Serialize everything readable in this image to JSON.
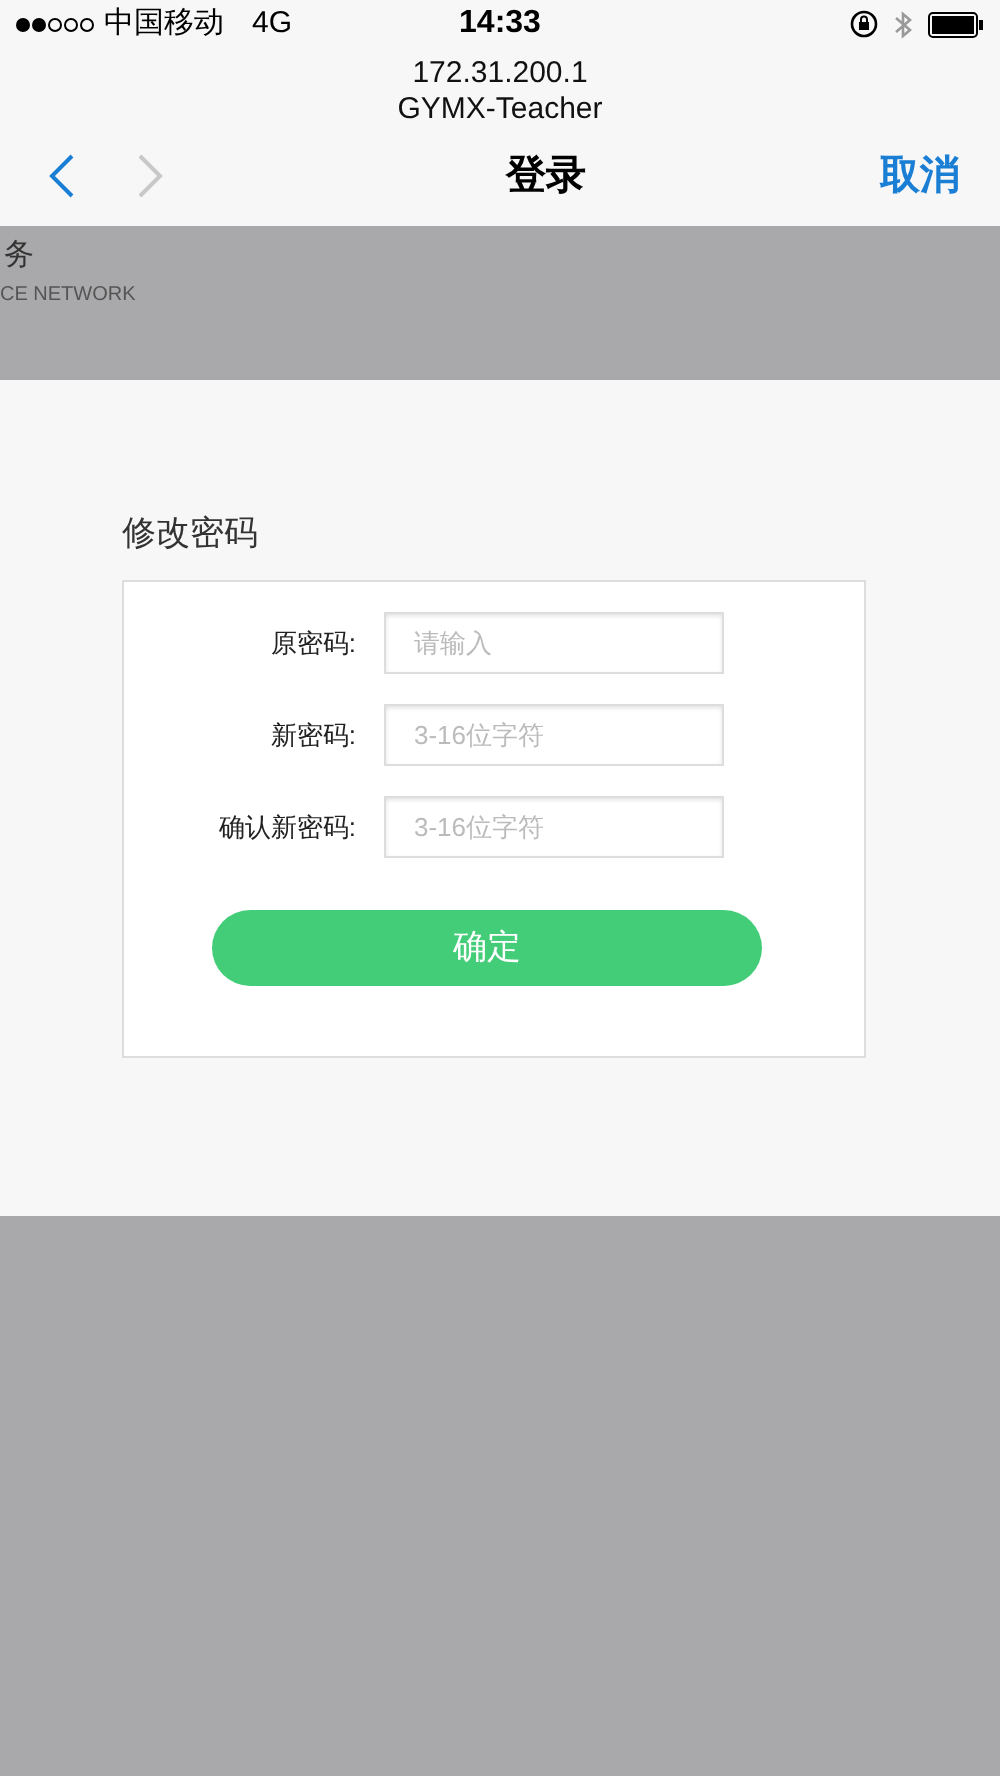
{
  "status_bar": {
    "signal_dots": [
      {
        "filled": true
      },
      {
        "filled": true
      },
      {
        "filled": false
      },
      {
        "filled": false
      },
      {
        "filled": false
      }
    ],
    "carrier": "中国移动",
    "network": "4G",
    "time": "14:33"
  },
  "browser": {
    "address": "172.31.200.1",
    "site_name": "GYMX-Teacher",
    "title": "登录",
    "back": {
      "disabled": false
    },
    "forward": {
      "disabled": true
    },
    "cancel": "取消"
  },
  "background_page": {
    "heading": "务",
    "subheading": "CE NETWORK"
  },
  "dialog": {
    "title": "修改密码",
    "fields": [
      {
        "label": "原密码:",
        "placeholder": "请输入"
      },
      {
        "label": "新密码:",
        "placeholder": "3-16位字符"
      },
      {
        "label": "确认新密码:",
        "placeholder": "3-16位字符"
      }
    ],
    "submit": "确定"
  }
}
